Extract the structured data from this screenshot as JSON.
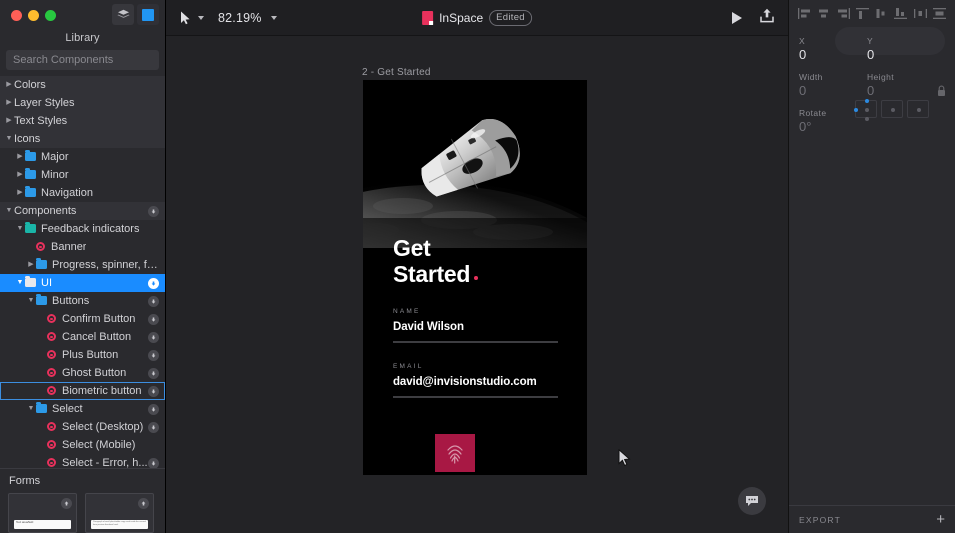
{
  "window": {
    "title": "InSpace",
    "status_badge": "Edited",
    "traffic_lights": [
      "close-red",
      "minimize-yellow",
      "maximize-green"
    ]
  },
  "sidebar": {
    "title": "Library",
    "search": {
      "placeholder": "Search Components",
      "value": ""
    },
    "toggles": [
      {
        "name": "layers-toggle",
        "active": false
      },
      {
        "name": "library-toggle",
        "active": true
      }
    ],
    "tree": [
      {
        "label": "Colors",
        "depth": 0,
        "type": "group",
        "twisty": "right",
        "badge": false
      },
      {
        "label": "Layer Styles",
        "depth": 0,
        "type": "group",
        "twisty": "right",
        "badge": false
      },
      {
        "label": "Text Styles",
        "depth": 0,
        "type": "group",
        "twisty": "right",
        "badge": false
      },
      {
        "label": "Icons",
        "depth": 0,
        "type": "group",
        "twisty": "down",
        "badge": false
      },
      {
        "label": "Major",
        "depth": 1,
        "type": "folder",
        "twisty": "right",
        "badge": false
      },
      {
        "label": "Minor",
        "depth": 1,
        "type": "folder",
        "twisty": "right",
        "badge": false
      },
      {
        "label": "Navigation",
        "depth": 1,
        "type": "folder",
        "twisty": "right",
        "badge": false
      },
      {
        "label": "Components",
        "depth": 0,
        "type": "group",
        "twisty": "down",
        "badge": true
      },
      {
        "label": "Feedback indicators",
        "depth": 1,
        "type": "folder-teal",
        "twisty": "down",
        "badge": false
      },
      {
        "label": "Banner",
        "depth": 2,
        "type": "symbol",
        "twisty": "none",
        "badge": false
      },
      {
        "label": "Progress, spinner, flash",
        "depth": 2,
        "type": "folder",
        "twisty": "right",
        "badge": false
      },
      {
        "label": "UI",
        "depth": 1,
        "type": "folder-white",
        "twisty": "down",
        "badge": true,
        "selected": true
      },
      {
        "label": "Buttons",
        "depth": 2,
        "type": "folder",
        "twisty": "down",
        "badge": true
      },
      {
        "label": "Confirm Button",
        "depth": 3,
        "type": "symbol",
        "twisty": "none",
        "badge": true
      },
      {
        "label": "Cancel Button",
        "depth": 3,
        "type": "symbol",
        "twisty": "none",
        "badge": true
      },
      {
        "label": "Plus Button",
        "depth": 3,
        "type": "symbol",
        "twisty": "none",
        "badge": true
      },
      {
        "label": "Ghost Button",
        "depth": 3,
        "type": "symbol",
        "twisty": "none",
        "badge": true
      },
      {
        "label": "Biometric button",
        "depth": 3,
        "type": "symbol",
        "twisty": "none",
        "badge": true,
        "outlined": true
      },
      {
        "label": "Select",
        "depth": 2,
        "type": "folder",
        "twisty": "down",
        "badge": true
      },
      {
        "label": "Select (Desktop)",
        "depth": 3,
        "type": "symbol",
        "twisty": "none",
        "badge": true
      },
      {
        "label": "Select (Mobile)",
        "depth": 3,
        "type": "symbol",
        "twisty": "none",
        "badge": false
      },
      {
        "label": "Select - Error, h...",
        "depth": 3,
        "type": "symbol",
        "twisty": "none",
        "badge": true
      }
    ],
    "forms": {
      "title": "Forms",
      "thumbnails": [
        {
          "name": "form-thumbnail-1",
          "text": "Text area/field"
        },
        {
          "name": "form-thumbnail-2",
          "text": "Paragraph of small placeholder copy used inside the second form preview thumbnail card."
        }
      ]
    }
  },
  "toolbar": {
    "tool": "pointer-tool",
    "zoom": "82.19%",
    "preview_label": "play-preview",
    "share_label": "share-export"
  },
  "canvas": {
    "artboard_label": "2 - Get Started",
    "artboard": {
      "heading_line1": "Get",
      "heading_line2": "Started",
      "fields": [
        {
          "caption": "NAME",
          "value": "David Wilson"
        },
        {
          "caption": "EMAIL",
          "value": "david@invisionstudio.com"
        }
      ],
      "cta": {
        "name": "biometric-button",
        "icon": "fingerprint-icon",
        "color": "#a81844"
      }
    },
    "chat_bubble": "comments-icon"
  },
  "inspector": {
    "align_icons": [
      "align-left-icon",
      "align-center-horizontal-icon",
      "align-right-icon",
      "align-top-icon",
      "align-middle-vertical-icon",
      "align-bottom-icon",
      "distribute-horizontal-icon",
      "distribute-vertical-icon"
    ],
    "properties": [
      {
        "label": "X",
        "value": "0"
      },
      {
        "label": "Y",
        "value": "0"
      },
      {
        "label": "Width",
        "value": "0"
      },
      {
        "label": "Height",
        "value": "0"
      },
      {
        "label": "Rotate",
        "value": "0°"
      }
    ],
    "lock_icon": "lock-aspect-ratio-icon",
    "anchor_control": "resize-anchor-control",
    "export": {
      "label": "EXPORT",
      "add": "+"
    }
  },
  "colors": {
    "accent_blue": "#1a8cff",
    "symbol_pink": "#e8315c",
    "cta_crimson": "#a81844",
    "panel_bg": "#2a2a2e",
    "canvas_bg": "#232326"
  }
}
